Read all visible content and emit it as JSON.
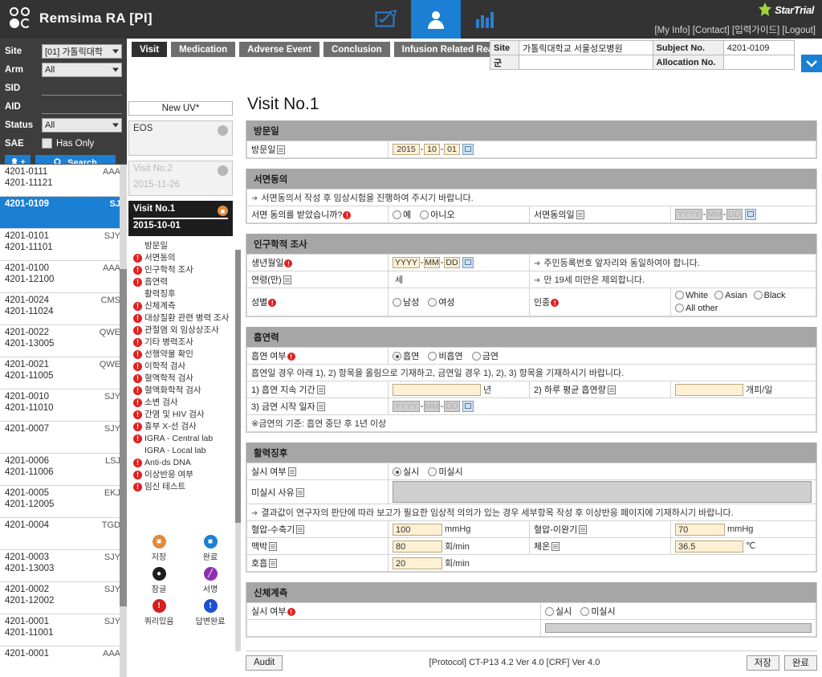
{
  "header": {
    "app_title": "Remsima RA [PI]",
    "logo_icon": "circles-logo-icon",
    "nav_icons": [
      {
        "name": "form-edit-icon",
        "label": "Form"
      },
      {
        "name": "subject-person-icon",
        "label": "Subject"
      },
      {
        "name": "bar-chart-icon",
        "label": "Statistics"
      }
    ],
    "links": "[My Info] [Contact] [입력가이드] [Logout]",
    "brand": "StarTrial"
  },
  "sidebar": {
    "filters": [
      {
        "label": "Site",
        "value": "[01] 가톨릭대학",
        "type": "select"
      },
      {
        "label": "Arm",
        "value": "All",
        "type": "select"
      },
      {
        "label": "SID",
        "value": "",
        "type": "line"
      },
      {
        "label": "AID",
        "value": "",
        "type": "line"
      },
      {
        "label": "Status",
        "value": "All",
        "type": "select"
      }
    ],
    "sae_label": "SAE",
    "sae_checkbox_label": "Has Only",
    "add_user_label": "add-user",
    "search_label": "Search",
    "subjects": [
      {
        "sid": "4201-0111",
        "aid": "4201-11121",
        "init": "AAA",
        "selected": false
      },
      {
        "sid": "4201-0109",
        "aid": "",
        "init": "SJ",
        "selected": true
      },
      {
        "sid": "4201-0101",
        "aid": "4201-11101",
        "init": "SJY",
        "selected": false
      },
      {
        "sid": "4201-0100",
        "aid": "4201-12100",
        "init": "AAA",
        "selected": false
      },
      {
        "sid": "4201-0024",
        "aid": "4201-11024",
        "init": "CMS",
        "selected": false
      },
      {
        "sid": "4201-0022",
        "aid": "4201-13005",
        "init": "QWE",
        "selected": false
      },
      {
        "sid": "4201-0021",
        "aid": "4201-11005",
        "init": "QWE",
        "selected": false
      },
      {
        "sid": "4201-0010",
        "aid": "4201-11010",
        "init": "SJY",
        "selected": false
      },
      {
        "sid": "4201-0007",
        "aid": "",
        "init": "SJY",
        "selected": false
      },
      {
        "sid": "4201-0006",
        "aid": "4201-11006",
        "init": "LSJ",
        "selected": false
      },
      {
        "sid": "4201-0005",
        "aid": "4201-12005",
        "init": "EKJ",
        "selected": false
      },
      {
        "sid": "4201-0004",
        "aid": "",
        "init": "TGD",
        "selected": false
      },
      {
        "sid": "4201-0003",
        "aid": "4201-13003",
        "init": "SJY",
        "selected": false
      },
      {
        "sid": "4201-0002",
        "aid": "4201-12002",
        "init": "SJY",
        "selected": false
      },
      {
        "sid": "4201-0001",
        "aid": "4201-11001",
        "init": "SJY",
        "selected": false
      },
      {
        "sid": "4201-0001",
        "aid": "",
        "init": "AAA",
        "selected": false
      }
    ]
  },
  "tabs": [
    {
      "label": "Visit",
      "active": true
    },
    {
      "label": "Medication",
      "active": false
    },
    {
      "label": "Adverse Event",
      "active": false
    },
    {
      "label": "Conclusion",
      "active": false
    },
    {
      "label": "Infusion Related Reaction",
      "active": false
    }
  ],
  "site_info": {
    "site_label": "Site",
    "site_value": "가톨릭대학교 서울성모병원",
    "subject_label": "Subject No.",
    "subject_value": "4201-0109",
    "arm_label": "군",
    "arm_value": "",
    "allocation_label": "Allocation No.",
    "allocation_value": ""
  },
  "visit_nav": {
    "new_uv_label": "New UV*",
    "cards": [
      {
        "title": "EOS",
        "date": "",
        "state": "normal"
      },
      {
        "title": "Visit No.2",
        "date": "2015-11-26",
        "state": "dim"
      },
      {
        "title": "Visit No.1",
        "date": "2015-10-01",
        "state": "current"
      }
    ],
    "items": [
      {
        "label": "방문일",
        "flag": false
      },
      {
        "label": "서면동의",
        "flag": true
      },
      {
        "label": "인구학적 조사",
        "flag": true
      },
      {
        "label": "흡연력",
        "flag": true
      },
      {
        "label": "활력징후",
        "flag": false
      },
      {
        "label": "신체계측",
        "flag": true
      },
      {
        "label": "대상질환 관련 병력 조사",
        "flag": true
      },
      {
        "label": "관절염 외 임상상조사",
        "flag": true
      },
      {
        "label": "기타 병력조사",
        "flag": true
      },
      {
        "label": "선행약물 확인",
        "flag": true
      },
      {
        "label": "이학적 검사",
        "flag": true
      },
      {
        "label": "혈액학적 검사",
        "flag": true
      },
      {
        "label": "혈액화학적 검사",
        "flag": true
      },
      {
        "label": "소변 검사",
        "flag": true
      },
      {
        "label": "간염 및 HIV 검사",
        "flag": true
      },
      {
        "label": "흉부 X-선 검사",
        "flag": true
      },
      {
        "label": "IGRA - Central lab",
        "flag": true
      },
      {
        "label": "IGRA - Local lab",
        "flag": false
      },
      {
        "label": "Anti-ds DNA",
        "flag": true
      },
      {
        "label": "이상반응 여부",
        "flag": true
      },
      {
        "label": "임신 테스트",
        "flag": true
      }
    ],
    "legend": [
      {
        "label": "저장",
        "icon": "save-icon",
        "color": "#e08a3c",
        "glyph": "■"
      },
      {
        "label": "완료",
        "icon": "complete-icon",
        "color": "#1b7fd4",
        "glyph": "■"
      },
      {
        "label": "잠글",
        "icon": "lock-icon",
        "color": "#1d1d1d",
        "glyph": "●"
      },
      {
        "label": "서명",
        "icon": "sign-icon",
        "color": "#8e2fb0",
        "glyph": "╱"
      },
      {
        "label": "쿼리있음",
        "icon": "query-open-icon",
        "color": "#d42020",
        "glyph": "!"
      },
      {
        "label": "답변완료",
        "icon": "query-answered-icon",
        "color": "#1b4fd4",
        "glyph": "!"
      }
    ]
  },
  "form": {
    "page_title": "Visit No.1",
    "sections": {
      "visit_date": {
        "title": "방문일",
        "label": "방문일",
        "year": "2015",
        "month": "10",
        "day": "01"
      },
      "consent": {
        "title": "서면동의",
        "note": "서면동의서 작성 후 임상시험을 진행하여 주시기 바랍니다.",
        "q_label": "서면 동의를 받았습니까?",
        "opt_yes": "예",
        "opt_no": "아니오",
        "date_label": "서면동의일",
        "date_y": "YYYY",
        "date_m": "MM",
        "date_d": "DD"
      },
      "demographics": {
        "title": "인구학적 조사",
        "dob_label": "생년월일",
        "dob_y": "YYYY",
        "dob_m": "MM",
        "dob_d": "DD",
        "dob_note": "주민등록번호 앞자리와 동일하여야 합니다.",
        "age_label": "연령(만)",
        "age_unit": "세",
        "age_note": "만 19세 미만은 제외합니다.",
        "sex_label": "성별",
        "sex_male": "남성",
        "sex_female": "여성",
        "race_label": "인종",
        "race_options": [
          "White",
          "Asian",
          "Black",
          "All other"
        ]
      },
      "smoking": {
        "title": "흡연력",
        "status_label": "흡연 여부",
        "opt_smoker": "흡연",
        "opt_nonsmoker": "비흡연",
        "opt_exsmoker": "금연",
        "note": "흡연일 경우 아래 1), 2) 항목을 올림으로 기재하고, 금연일 경우 1), 2), 3) 항목을 기재하시기 바랍니다.",
        "dur_label": "1) 흡연 지속 기간",
        "dur_value": "",
        "dur_unit": "년",
        "amount_label": "2) 하루 평균 흡연량",
        "amount_value": "",
        "amount_unit": "개피/일",
        "quit_label": "3) 금연 시작 일자",
        "quit_y": "YYYY",
        "quit_m": "MM",
        "quit_d": "DD",
        "footnote": "※금연의 기준: 흡연 중단 후 1년 이상"
      },
      "vitals": {
        "title": "활력징후",
        "done_label": "실시 여부",
        "opt_done": "실시",
        "opt_notdone": "미실시",
        "reason_label": "미실시 사유",
        "reason_value": "",
        "note": "결과값이 연구자의 판단에 따라 보고가 필요한 임상적 의의가 있는 경우 세부항목 작성 후 이상반응 페이지에 기재하시기 바랍니다.",
        "sbp_label": "혈압-수축기",
        "sbp_value": "100",
        "sbp_unit": "mmHg",
        "dbp_label": "혈압-이완기",
        "dbp_value": "70",
        "dbp_unit": "mmHg",
        "pulse_label": "맥박",
        "pulse_value": "80",
        "pulse_unit": "회/min",
        "temp_label": "체온",
        "temp_value": "36.5",
        "temp_unit": "℃",
        "resp_label": "호흡",
        "resp_value": "20",
        "resp_unit": "회/min"
      },
      "anthropometry": {
        "title": "신체계측",
        "done_label": "실시 여부",
        "opt_done": "실시",
        "opt_notdone": "미실시"
      }
    }
  },
  "footer": {
    "audit_label": "Audit",
    "protocol": "[Protocol] CT-P13 4.2 Ver 4.0 [CRF] Ver 4.0",
    "save_label": "저장",
    "complete_label": "완료"
  }
}
